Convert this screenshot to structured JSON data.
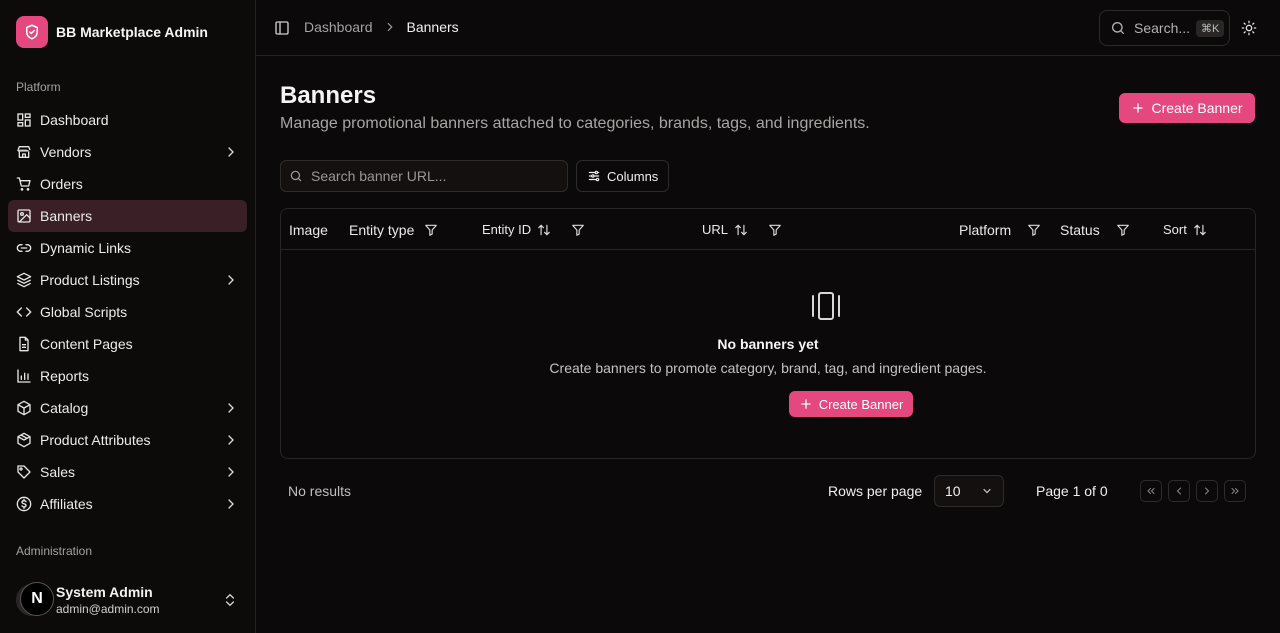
{
  "app": {
    "name": "BB Marketplace Admin"
  },
  "sidebar": {
    "platform_label": "Platform",
    "admin_label": "Administration",
    "items": [
      {
        "label": "Dashboard",
        "icon": "dashboard-icon",
        "chevron": false
      },
      {
        "label": "Vendors",
        "icon": "store-icon",
        "chevron": true
      },
      {
        "label": "Orders",
        "icon": "cart-icon",
        "chevron": false
      },
      {
        "label": "Banners",
        "icon": "image-icon",
        "chevron": false,
        "active": true
      },
      {
        "label": "Dynamic Links",
        "icon": "link-icon",
        "chevron": false
      },
      {
        "label": "Product Listings",
        "icon": "layers-icon",
        "chevron": true
      },
      {
        "label": "Global Scripts",
        "icon": "code-icon",
        "chevron": false
      },
      {
        "label": "Content Pages",
        "icon": "file-icon",
        "chevron": false
      },
      {
        "label": "Reports",
        "icon": "chart-icon",
        "chevron": false
      },
      {
        "label": "Catalog",
        "icon": "box-icon",
        "chevron": true
      },
      {
        "label": "Product Attributes",
        "icon": "package-icon",
        "chevron": true
      },
      {
        "label": "Sales",
        "icon": "tag-icon",
        "chevron": true
      },
      {
        "label": "Affiliates",
        "icon": "dollar-icon",
        "chevron": true
      }
    ],
    "user": {
      "initial": "N",
      "name": "System Admin",
      "email": "admin@admin.com"
    }
  },
  "topbar": {
    "breadcrumb": [
      "Dashboard",
      "Banners"
    ],
    "search_label": "Search...",
    "search_shortcut": "⌘K"
  },
  "page": {
    "title": "Banners",
    "subtitle": "Manage promotional banners attached to categories, brands, tags, and ingredients.",
    "create_button": "Create Banner",
    "search_placeholder": "Search banner URL...",
    "columns_button": "Columns"
  },
  "table": {
    "columns": [
      {
        "label": "Image",
        "sort": false,
        "filter": false
      },
      {
        "label": "Entity type",
        "sort": false,
        "filter": true
      },
      {
        "label": "Entity ID",
        "sort": true,
        "filter": true
      },
      {
        "label": "URL",
        "sort": true,
        "filter": true
      },
      {
        "label": "Platform",
        "sort": false,
        "filter": true
      },
      {
        "label": "Status",
        "sort": false,
        "filter": true
      },
      {
        "label": "Sort",
        "sort": true,
        "filter": false
      }
    ],
    "empty": {
      "title": "No banners yet",
      "description": "Create banners to promote category, brand, tag, and ingredient pages.",
      "button": "Create Banner"
    }
  },
  "footer": {
    "results": "No results",
    "rows_per_page_label": "Rows per page",
    "rows_per_page_value": "10",
    "page_info": "Page 1 of 0"
  },
  "colors": {
    "accent": "#e5487f",
    "active_nav": "#3a1f27",
    "background": "#0b0909"
  }
}
